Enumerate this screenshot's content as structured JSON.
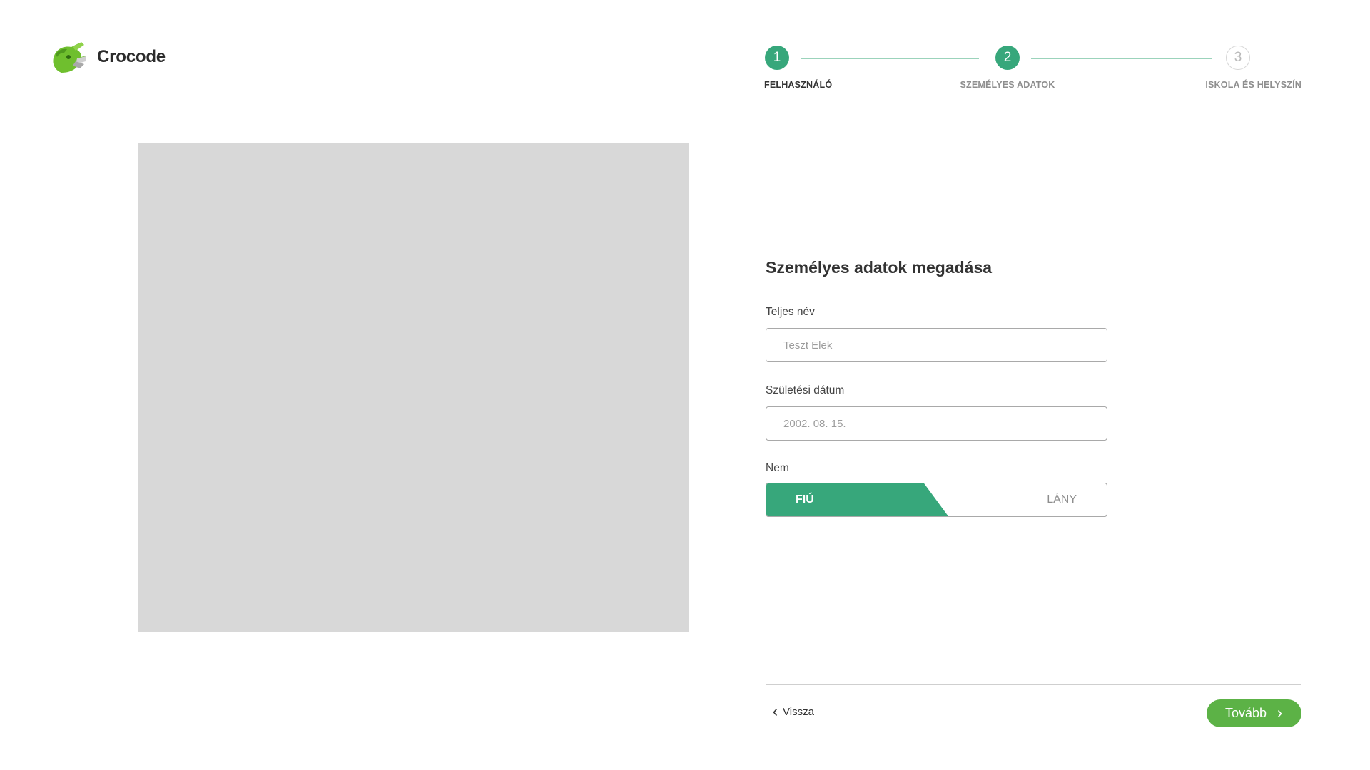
{
  "app": {
    "name": "Crocode"
  },
  "stepper": {
    "steps": [
      {
        "number": "1",
        "label": "FELHASZNÁLÓ",
        "state": "completed"
      },
      {
        "number": "2",
        "label": "SZEMÉLYES ADATOK",
        "state": "active"
      },
      {
        "number": "3",
        "label": "ISKOLA ÉS HELYSZÍN",
        "state": "upcoming"
      }
    ],
    "current_step": 2
  },
  "form": {
    "title": "Személyes adatok megadása",
    "full_name": {
      "label": "Teljes név",
      "value": "",
      "placeholder": "Teszt Elek"
    },
    "birth_date": {
      "label": "Születési dátum",
      "value": "",
      "placeholder": "2002. 08. 15."
    },
    "gender": {
      "label": "Nem",
      "options": [
        "FIÚ",
        "LÁNY"
      ],
      "selected": "FIÚ"
    }
  },
  "footer": {
    "back_label": "Vissza",
    "next_label": "Tovább"
  },
  "colors": {
    "accent": "#37a77b",
    "button": "#5cb246",
    "placeholder_image": "#d8d8d8"
  },
  "icons": {
    "logo": "crocodile-logo-icon",
    "back": "chevron-left-icon",
    "next": "chevron-right-icon"
  }
}
